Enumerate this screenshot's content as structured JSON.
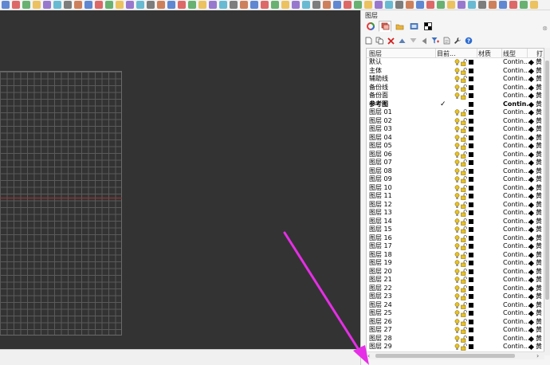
{
  "panel": {
    "title": "图层",
    "close_glyph": "⊗"
  },
  "table": {
    "columns": [
      "图层",
      "目前...",
      "材质",
      "线型",
      "打"
    ],
    "rows": [
      {
        "name": "默认",
        "linetype": "Contin...",
        "current": false,
        "print_width": "黄"
      },
      {
        "name": "主体",
        "linetype": "Contin...",
        "current": false,
        "print_width": "黄"
      },
      {
        "name": "辅助线",
        "linetype": "Contin...",
        "current": false,
        "print_width": "黄"
      },
      {
        "name": "备份线",
        "linetype": "Contin...",
        "current": false,
        "print_width": "黄"
      },
      {
        "name": "备份面",
        "linetype": "Contin...",
        "current": false,
        "print_width": "黄"
      },
      {
        "name": "参考图",
        "linetype": "Contin...",
        "current": true,
        "print_width": "黄"
      },
      {
        "name": "图层 01",
        "linetype": "Contin...",
        "current": false,
        "print_width": "黄"
      },
      {
        "name": "图层 02",
        "linetype": "Contin...",
        "current": false,
        "print_width": "黄"
      },
      {
        "name": "图层 03",
        "linetype": "Contin...",
        "current": false,
        "print_width": "黄"
      },
      {
        "name": "图层 04",
        "linetype": "Contin...",
        "current": false,
        "print_width": "黄"
      },
      {
        "name": "图层 05",
        "linetype": "Contin...",
        "current": false,
        "print_width": "黄"
      },
      {
        "name": "图层 06",
        "linetype": "Contin...",
        "current": false,
        "print_width": "黄"
      },
      {
        "name": "图层 07",
        "linetype": "Contin...",
        "current": false,
        "print_width": "黄"
      },
      {
        "name": "图层 08",
        "linetype": "Contin...",
        "current": false,
        "print_width": "黄"
      },
      {
        "name": "图层 09",
        "linetype": "Contin...",
        "current": false,
        "print_width": "黄"
      },
      {
        "name": "图层 10",
        "linetype": "Contin...",
        "current": false,
        "print_width": "黄"
      },
      {
        "name": "图层 11",
        "linetype": "Contin...",
        "current": false,
        "print_width": "黄"
      },
      {
        "name": "图层 12",
        "linetype": "Contin...",
        "current": false,
        "print_width": "黄"
      },
      {
        "name": "图层 13",
        "linetype": "Contin...",
        "current": false,
        "print_width": "黄"
      },
      {
        "name": "图层 14",
        "linetype": "Contin...",
        "current": false,
        "print_width": "黄"
      },
      {
        "name": "图层 15",
        "linetype": "Contin...",
        "current": false,
        "print_width": "黄"
      },
      {
        "name": "图层 16",
        "linetype": "Contin...",
        "current": false,
        "print_width": "黄"
      },
      {
        "name": "图层 17",
        "linetype": "Contin...",
        "current": false,
        "print_width": "黄"
      },
      {
        "name": "图层 18",
        "linetype": "Contin...",
        "current": false,
        "print_width": "黄"
      },
      {
        "name": "图层 19",
        "linetype": "Contin...",
        "current": false,
        "print_width": "黄"
      },
      {
        "name": "图层 20",
        "linetype": "Contin...",
        "current": false,
        "print_width": "黄"
      },
      {
        "name": "图层 21",
        "linetype": "Contin...",
        "current": false,
        "print_width": "黄"
      },
      {
        "name": "图层 22",
        "linetype": "Contin...",
        "current": false,
        "print_width": "黄"
      },
      {
        "name": "图层 23",
        "linetype": "Contin...",
        "current": false,
        "print_width": "黄"
      },
      {
        "name": "图层 24",
        "linetype": "Contin...",
        "current": false,
        "print_width": "黄"
      },
      {
        "name": "图层 25",
        "linetype": "Contin...",
        "current": false,
        "print_width": "黄"
      },
      {
        "name": "图层 26",
        "linetype": "Contin...",
        "current": false,
        "print_width": "黄"
      },
      {
        "name": "图层 27",
        "linetype": "Contin...",
        "current": false,
        "print_width": "黄"
      },
      {
        "name": "图层 28",
        "linetype": "Contin...",
        "current": false,
        "print_width": "黄"
      },
      {
        "name": "图层 29",
        "linetype": "Contin...",
        "current": false,
        "print_width": "黄"
      }
    ],
    "current_mark": "✓"
  },
  "colors": {
    "viewport_bg": "#333333",
    "grid_line": "#5a5a5a",
    "x_axis": "#a13232",
    "arrow": "#e62ee6",
    "bulb": "#e8c21e",
    "lock": "#e8c21e"
  },
  "icons": {
    "tabs": [
      "color-wheel-icon",
      "layers-icon",
      "folder-icon",
      "display-icon",
      "checker-icon"
    ],
    "tools": [
      "new-layer-icon",
      "new-sublayer-icon",
      "delete-icon",
      "move-up-icon",
      "move-down-icon",
      "arrow-left-icon",
      "filter-icon",
      "document-icon",
      "wrench-icon",
      "help-icon"
    ]
  }
}
